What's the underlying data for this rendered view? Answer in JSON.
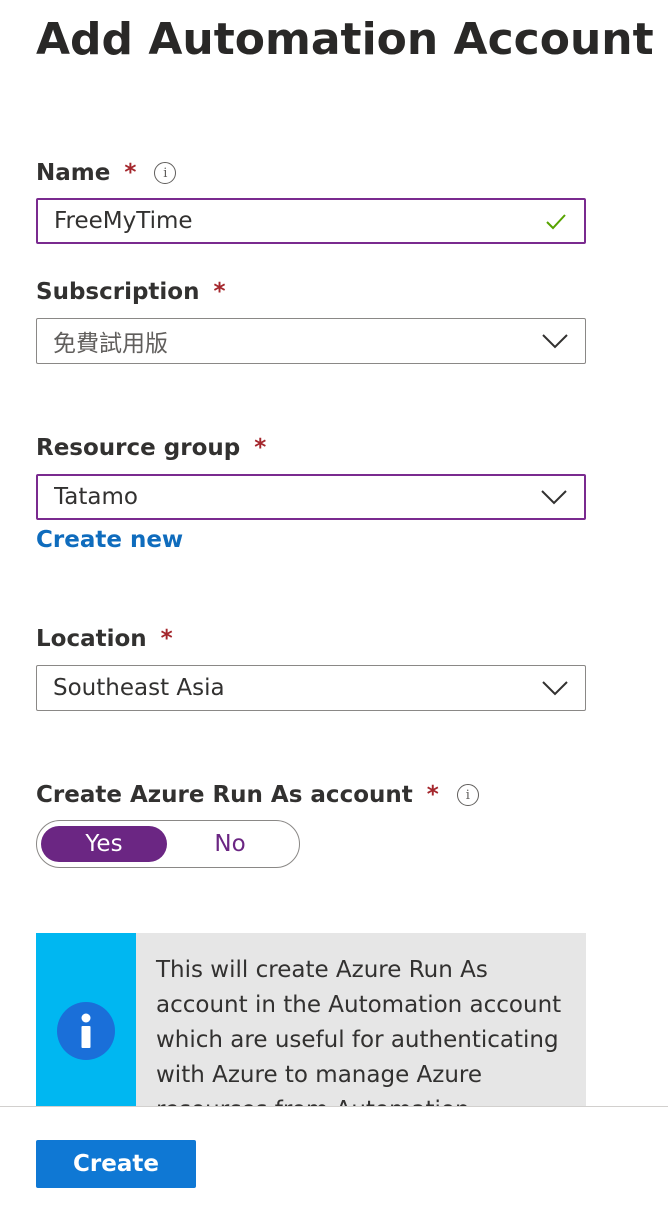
{
  "page": {
    "title": "Add Automation Account"
  },
  "form": {
    "name": {
      "label": "Name",
      "required_mark": "*",
      "value": "FreeMyTime",
      "valid": true
    },
    "subscription": {
      "label": "Subscription",
      "required_mark": "*",
      "value": "免費試用版"
    },
    "resource_group": {
      "label": "Resource group",
      "required_mark": "*",
      "value": "Tatamo",
      "create_new_label": "Create new"
    },
    "location": {
      "label": "Location",
      "required_mark": "*",
      "value": "Southeast Asia"
    },
    "run_as": {
      "label": "Create Azure Run As account",
      "required_mark": "*",
      "options": [
        "Yes",
        "No"
      ],
      "selected": "Yes"
    }
  },
  "info_message": {
    "icon": "info-icon",
    "text": "This will create Azure Run As account in the Automation account which are useful for authenticating with Azure to manage Azure resources from Automation"
  },
  "footer": {
    "create_label": "Create"
  },
  "colors": {
    "accent_purple": "#6b2683",
    "link_blue": "#0f6cbd",
    "primary_button": "#0f78d4",
    "required_red": "#a4262c",
    "info_strip": "#00b7f1",
    "valid_check": "#57a300"
  }
}
